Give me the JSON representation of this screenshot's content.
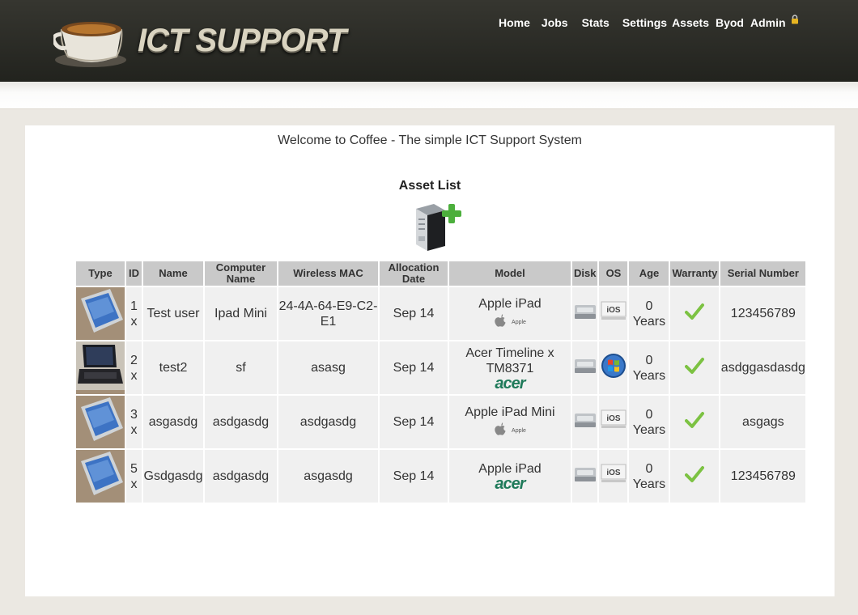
{
  "header": {
    "logo_text": "ICT SUPPORT",
    "nav": [
      "Home",
      "Jobs",
      "Stats",
      "Settings",
      "Assets",
      "Byod",
      "Admin"
    ]
  },
  "main": {
    "welcome": "Welcome to Coffee - The simple ICT Support System",
    "asset_list_title": "Asset List"
  },
  "table": {
    "headers": {
      "type": "Type",
      "id": "ID",
      "name": "Name",
      "computer_name_1": "Computer",
      "computer_name_2": "Name",
      "mac": "Wireless MAC",
      "alloc_1": "Allocation",
      "alloc_2": "Date",
      "model": "Model",
      "disk": "Disk",
      "os": "OS",
      "age": "Age",
      "warranty": "Warranty",
      "serial": "Serial Number"
    },
    "rows": [
      {
        "image": "ipad-photo",
        "id_num": "1",
        "id_x": "x",
        "name": "Test user",
        "computer_name": "Ipad Mini",
        "mac": "24-4A-64-E9-C2-E1",
        "allocation_date": "Sep 14",
        "model": "Apple iPad",
        "brand": "apple",
        "brand_label": "Apple",
        "os": "iOS",
        "age_num": "0",
        "age_unit": "Years",
        "warranty": "check",
        "serial": "123456789"
      },
      {
        "image": "laptop-photo",
        "id_num": "2",
        "id_x": "x",
        "name": "test2",
        "computer_name": "sf",
        "mac": "asasg",
        "allocation_date": "Sep 14",
        "model": "Acer Timeline x TM8371",
        "brand": "acer",
        "brand_label": "acer",
        "os": "windows",
        "age_num": "0",
        "age_unit": "Years",
        "warranty": "check",
        "serial": "asdggasdasdg"
      },
      {
        "image": "ipad-photo",
        "id_num": "3",
        "id_x": "x",
        "name": "asgasdg",
        "computer_name": "asdgasdg",
        "mac": "asdgasdg",
        "allocation_date": "Sep 14",
        "model": "Apple iPad Mini",
        "brand": "apple",
        "brand_label": "Apple",
        "os": "iOS",
        "age_num": "0",
        "age_unit": "Years",
        "warranty": "check",
        "serial": "asgags"
      },
      {
        "image": "ipad-photo",
        "id_num": "5",
        "id_x": "x",
        "name": "Gsdgasdg",
        "computer_name": "asdgasdg",
        "mac": "asgasdg",
        "allocation_date": "Sep 14",
        "model": "Apple iPad",
        "brand": "acer",
        "brand_label": "acer",
        "os": "iOS",
        "age_num": "0",
        "age_unit": "Years",
        "warranty": "check",
        "serial": "123456789"
      }
    ]
  },
  "colors": {
    "header_bg": "#2a2b25",
    "table_header_bg": "#c9c9c9",
    "cell_bg": "#f0f0f0",
    "check_green": "#7cc242",
    "acer_green": "#1f7a5a"
  }
}
